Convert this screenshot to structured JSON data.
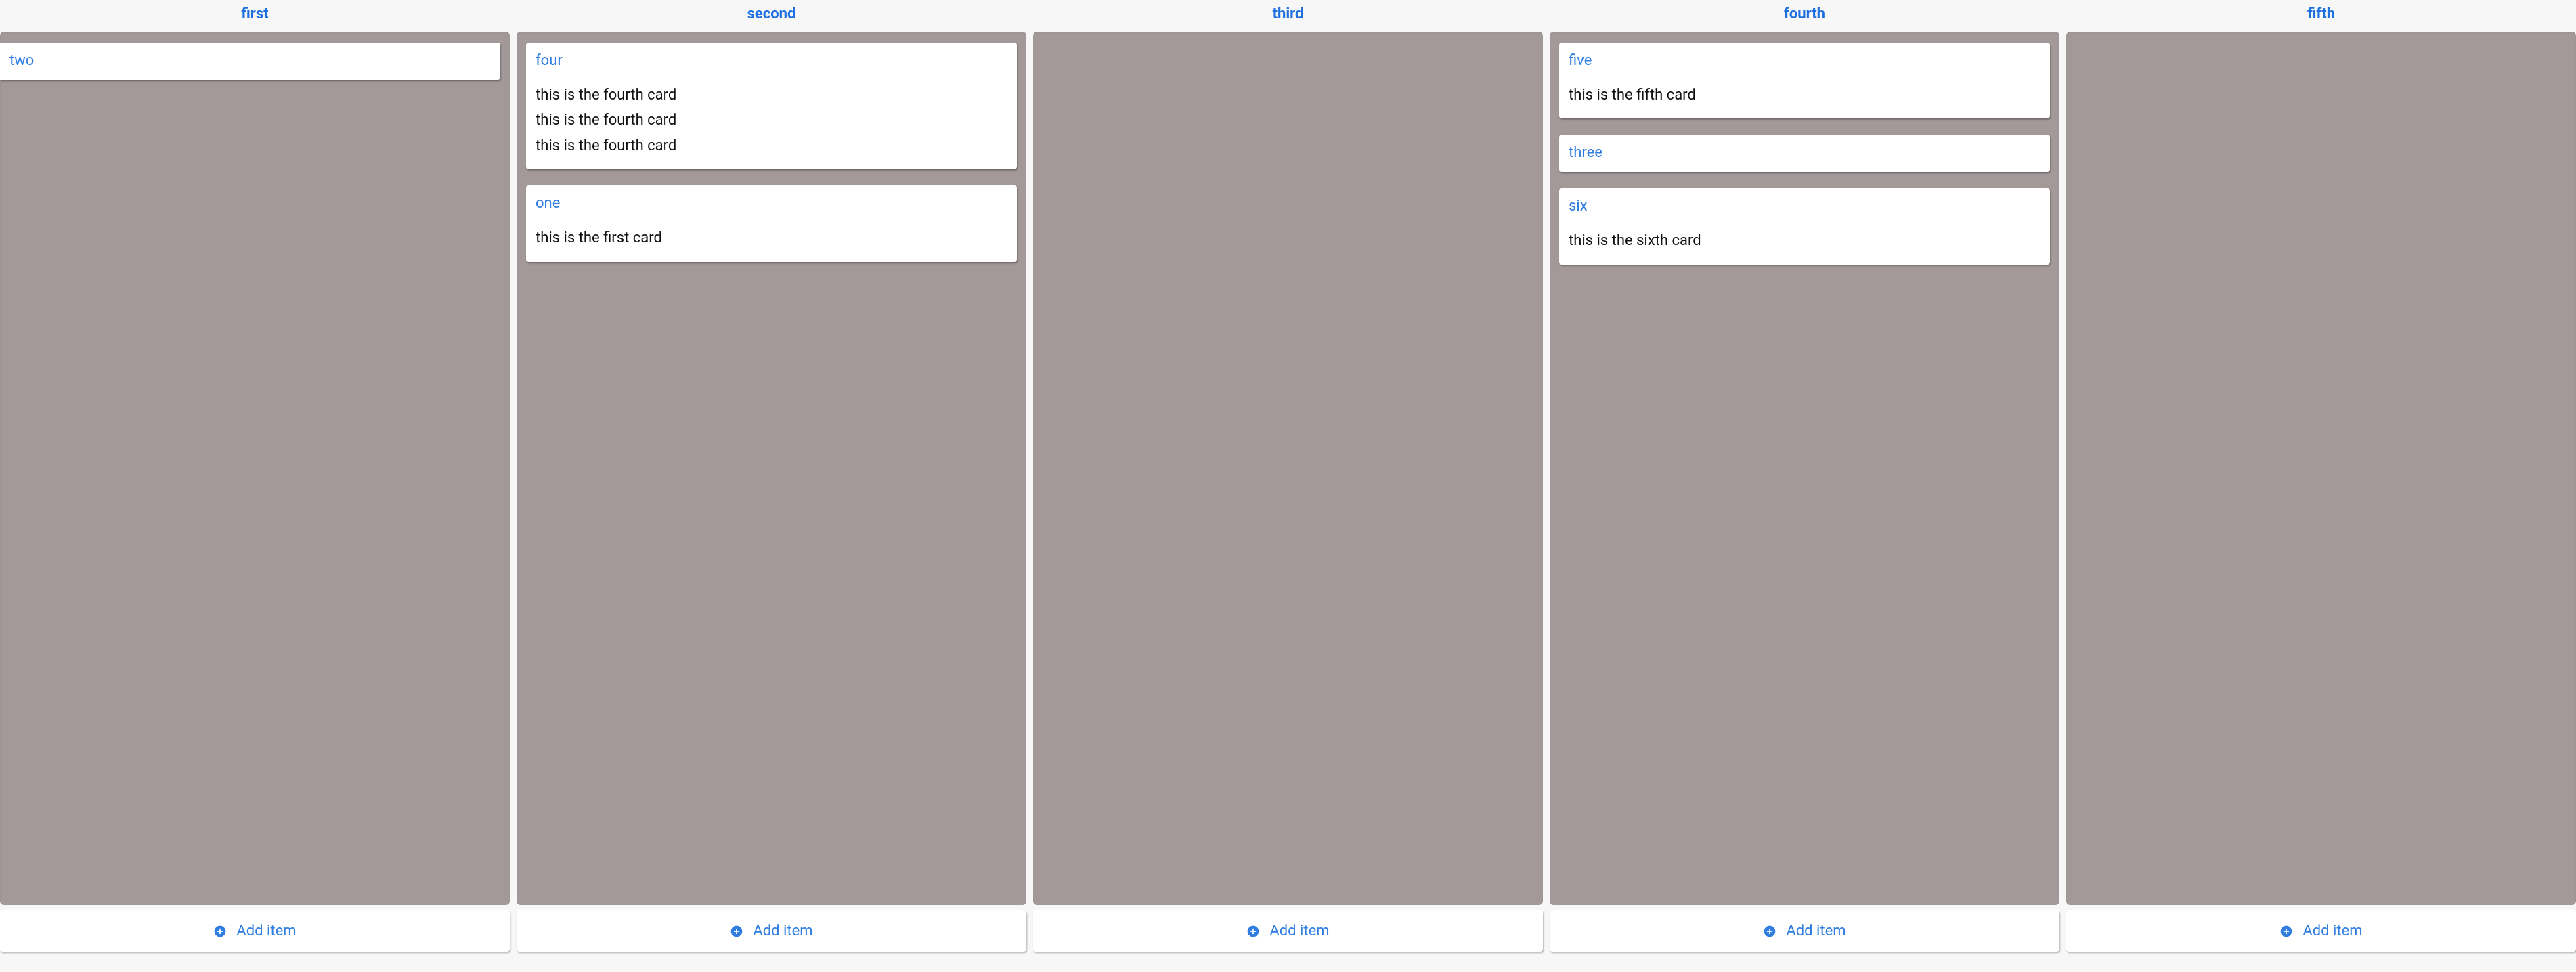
{
  "add_item_label": "Add item",
  "columns": [
    {
      "title": "first",
      "cards": [
        {
          "title": "two",
          "body": ""
        }
      ]
    },
    {
      "title": "second",
      "cards": [
        {
          "title": "four",
          "body": "this is the fourth card\nthis is the fourth card\nthis is the fourth card"
        },
        {
          "title": "one",
          "body": "this is the first card"
        }
      ]
    },
    {
      "title": "third",
      "cards": []
    },
    {
      "title": "fourth",
      "cards": [
        {
          "title": "five",
          "body": "this is the fifth card"
        },
        {
          "title": "three",
          "body": ""
        },
        {
          "title": "six",
          "body": "this is the sixth card"
        }
      ]
    },
    {
      "title": "fifth",
      "cards": []
    }
  ]
}
